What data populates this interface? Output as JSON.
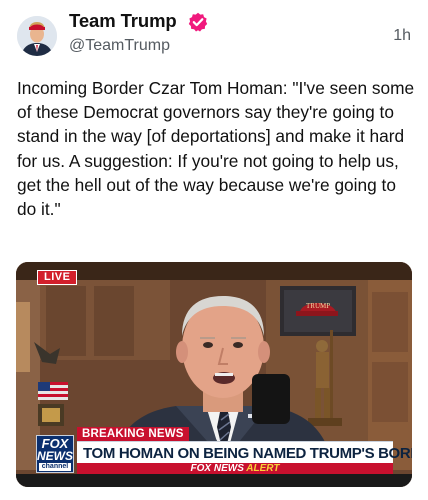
{
  "post": {
    "author": {
      "display_name": "Team Trump",
      "handle": "@TeamTrump",
      "verified": true
    },
    "timestamp": "1h",
    "text": "Incoming Border Czar Tom Homan: \"I've seen some of these Democrat governors say they're going to stand in the way [of deportations] and make it hard for us. A suggestion: If you're not going to help us, get the hell out of the way because we're going to do it.\""
  },
  "media": {
    "live_label": "LIVE",
    "channel_logo": {
      "line1": "FOX",
      "line2": "NEWS",
      "line3": "channel"
    },
    "breaking_label": "BREAKING NEWS",
    "headline": "TOM HOMAN ON BEING NAMED TRUMP'S BORDER CZAR",
    "alert_brand": "FOX NEWS",
    "alert_word": "ALERT",
    "background_sign": "TRUMP"
  },
  "colors": {
    "verified_badge": "#f0197d",
    "fox_red": "#c8102e",
    "fox_navy": "#0b2f6e",
    "text_primary": "#111111",
    "text_secondary": "#555b61"
  },
  "icons": {
    "verified": "verified-badge-icon"
  }
}
